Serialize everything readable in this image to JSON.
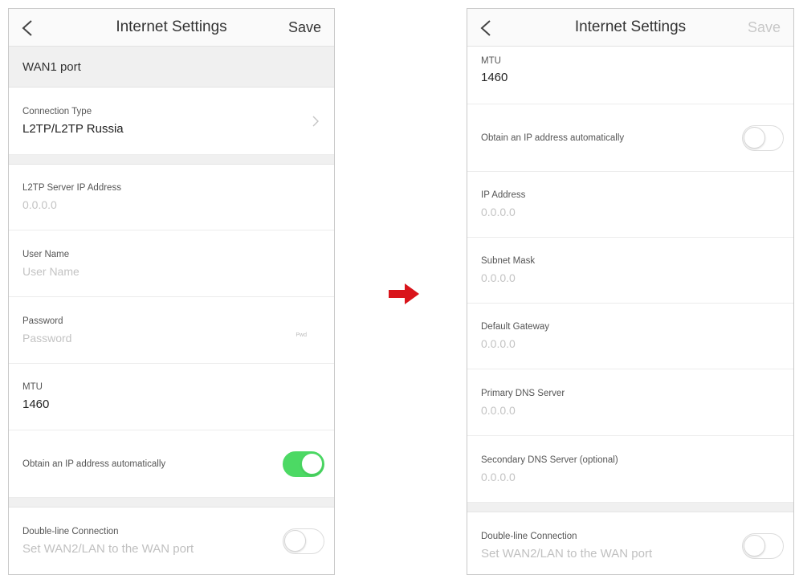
{
  "left": {
    "nav": {
      "title": "Internet Settings",
      "save": "Save"
    },
    "section_title": "WAN1 port",
    "connection_type": {
      "label": "Connection Type",
      "value": "L2TP/L2TP Russia"
    },
    "server_ip": {
      "label": "L2TP Server IP Address",
      "placeholder": "0.0.0.0"
    },
    "user_name": {
      "label": "User Name",
      "placeholder": "User Name"
    },
    "password": {
      "label": "Password",
      "placeholder": "Password",
      "eye": "Pwd"
    },
    "mtu": {
      "label": "MTU",
      "value": "1460"
    },
    "obtain_ip": {
      "label": "Obtain an IP address automatically",
      "toggle_on": true
    },
    "double_line": {
      "label": "Double-line Connection",
      "sub": "Set WAN2/LAN to the WAN port",
      "toggle_on": false
    }
  },
  "right": {
    "nav": {
      "title": "Internet Settings",
      "save": "Save"
    },
    "mtu": {
      "label": "MTU",
      "value": "1460"
    },
    "obtain_ip": {
      "label": "Obtain an IP address automatically",
      "toggle_on": false
    },
    "ip_address": {
      "label": "IP Address",
      "placeholder": "0.0.0.0"
    },
    "subnet_mask": {
      "label": "Subnet Mask",
      "placeholder": "0.0.0.0"
    },
    "default_gateway": {
      "label": "Default Gateway",
      "placeholder": "0.0.0.0"
    },
    "primary_dns": {
      "label": "Primary DNS Server",
      "placeholder": "0.0.0.0"
    },
    "secondary_dns": {
      "label": "Secondary DNS Server (optional)",
      "placeholder": "0.0.0.0"
    },
    "double_line": {
      "label": "Double-line Connection",
      "sub": "Set WAN2/LAN to the WAN port",
      "toggle_on": false
    }
  },
  "icons": {
    "back": "chevron-left-icon",
    "chevron": "chevron-right-icon",
    "transition_arrow": "arrow-right-icon"
  },
  "colors": {
    "toggle_on": "#4cd964",
    "arrow": "#d9141b",
    "disabled_text": "#c8c8c8"
  }
}
